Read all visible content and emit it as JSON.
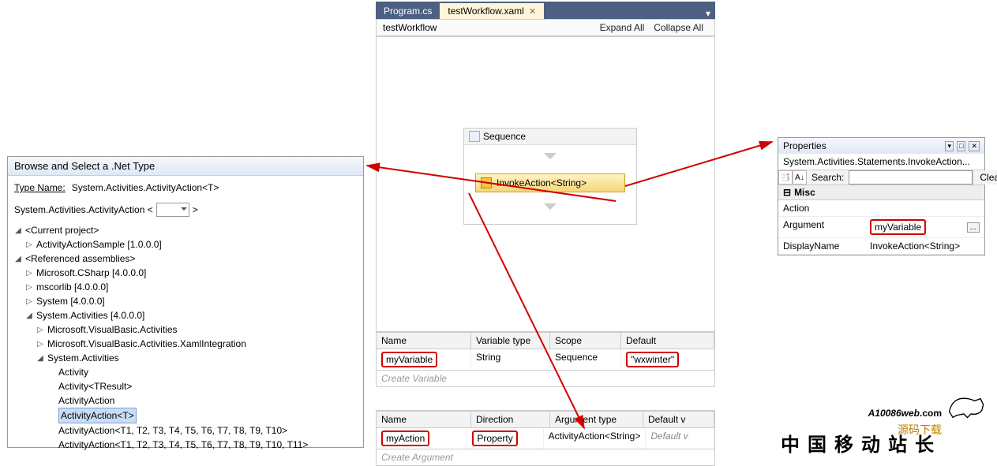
{
  "browse": {
    "title": "Browse and Select a .Net Type",
    "typeNameLabel": "Type Name:",
    "typeNameValue": "System.Activities.ActivityAction<T>",
    "comboPrefix": "System.Activities.ActivityAction <",
    "comboSuffix": ">",
    "tree": {
      "currentProject": "<Current project>",
      "activitySample": "ActivityActionSample [1.0.0.0]",
      "refAssemblies": "<Referenced assemblies>",
      "msCSharp": "Microsoft.CSharp [4.0.0.0]",
      "mscorlib": "mscorlib [4.0.0.0]",
      "system": "System [4.0.0.0]",
      "sysActivities": "System.Activities [4.0.0.0]",
      "vbActivities": "Microsoft.VisualBasic.Activities",
      "vbXaml": "Microsoft.VisualBasic.Activities.XamlIntegration",
      "sysActivitiesNS": "System.Activities",
      "activity": "Activity",
      "activityTResult": "Activity<TResult>",
      "activityAction": "ActivityAction",
      "activityActionT": "ActivityAction<T>",
      "activityActionT10": "ActivityAction<T1, T2, T3, T4, T5, T6, T7, T8, T9, T10>",
      "activityActionT11": "ActivityAction<T1, T2, T3, T4, T5, T6, T7, T8, T9, T10, T11>"
    }
  },
  "tabs": {
    "tab1": "Program.cs",
    "tab2": "testWorkflow.xaml"
  },
  "designer": {
    "breadcrumb": "testWorkflow",
    "expandAll": "Expand All",
    "collapseAll": "Collapse All",
    "sequence": "Sequence",
    "invoke": "InvokeAction<String>"
  },
  "varGrid": {
    "h1": "Name",
    "h2": "Variable type",
    "h3": "Scope",
    "h4": "Default",
    "r1c1": "myVariable",
    "r1c2": "String",
    "r1c3": "Sequence",
    "r1c4": "\"wxwinter\"",
    "create": "Create Variable"
  },
  "argGrid": {
    "h1": "Name",
    "h2": "Direction",
    "h3": "Argument type",
    "h4": "Default v",
    "r1c1": "myAction",
    "r1c2": "Property",
    "r1c3": "ActivityAction<String>",
    "r1c4": "Default v",
    "create": "Create Argument"
  },
  "props": {
    "title": "Properties",
    "sub": "System.Activities.Statements.InvokeAction...",
    "searchLabel": "Search:",
    "clear": "Clear",
    "misc": "Misc",
    "action": "Action",
    "argument": "Argument",
    "argVal": "myVariable",
    "displayName": "DisplayName",
    "displayVal": "InvokeAction<String>"
  },
  "watermark": {
    "domain": "10086web",
    "ext": ".com",
    "sub": "源码下载",
    "cn": "中国移动站长"
  }
}
